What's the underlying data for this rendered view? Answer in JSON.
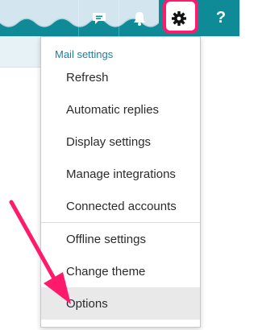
{
  "header": {
    "buttons": [
      {
        "icon": "chat-icon"
      },
      {
        "icon": "bell-icon"
      },
      {
        "icon": "gear-icon",
        "highlighted": true
      },
      {
        "icon": "help-icon",
        "label": "?"
      }
    ],
    "colors": {
      "bar": "#0f8b98",
      "wave": "#d3e5ef",
      "highlight": "#ff1a6c"
    }
  },
  "menu": {
    "header": "Mail settings",
    "items": [
      {
        "label": "Refresh"
      },
      {
        "label": "Automatic replies"
      },
      {
        "label": "Display settings"
      },
      {
        "label": "Manage integrations"
      },
      {
        "label": "Connected accounts"
      },
      {
        "label": "Offline settings"
      },
      {
        "label": "Change theme"
      },
      {
        "label": "Options",
        "hovered": true
      }
    ]
  },
  "annotation": {
    "arrow_color": "#ff1a6c"
  }
}
